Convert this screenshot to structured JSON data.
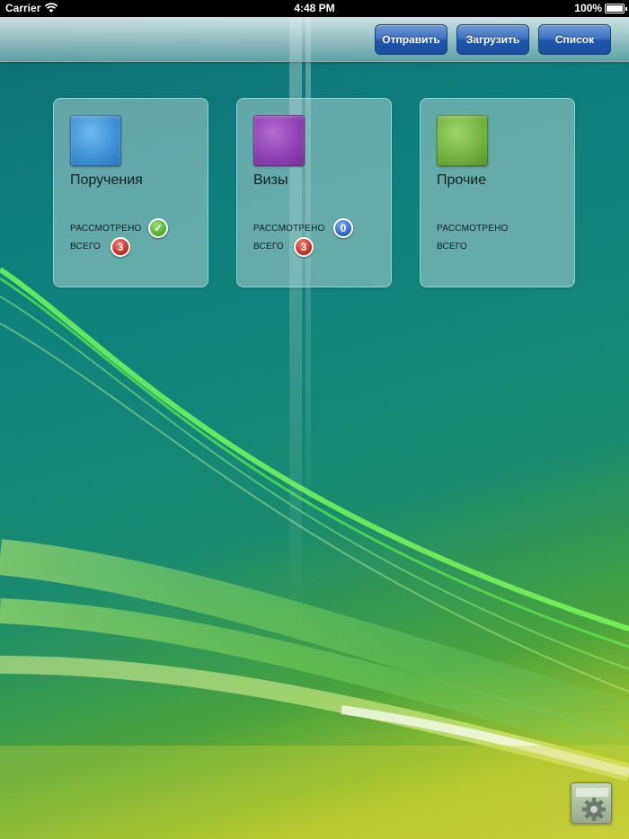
{
  "status_bar": {
    "carrier": "Carrier",
    "time": "4:48 PM",
    "battery": "100%"
  },
  "toolbar": {
    "send_label": "Отправить",
    "load_label": "Загрузить",
    "list_label": "Список"
  },
  "cards": [
    {
      "title": "Поручения",
      "color": "#3b8fd3",
      "reviewed_label": "РАССМОТРЕНО",
      "reviewed_badge": "✓",
      "total_label": "ВСЕГО",
      "total_value": "3"
    },
    {
      "title": "Визы",
      "color": "#8a3fb2",
      "reviewed_label": "РАССМОТРЕНО",
      "reviewed_value": "0",
      "total_label": "ВСЕГО",
      "total_value": "3"
    },
    {
      "title": "Прочие",
      "color": "#6eb03d",
      "reviewed_label": "РАССМОТРЕНО",
      "total_label": "ВСЕГО"
    }
  ],
  "icons": {
    "settings": "gear-icon"
  }
}
